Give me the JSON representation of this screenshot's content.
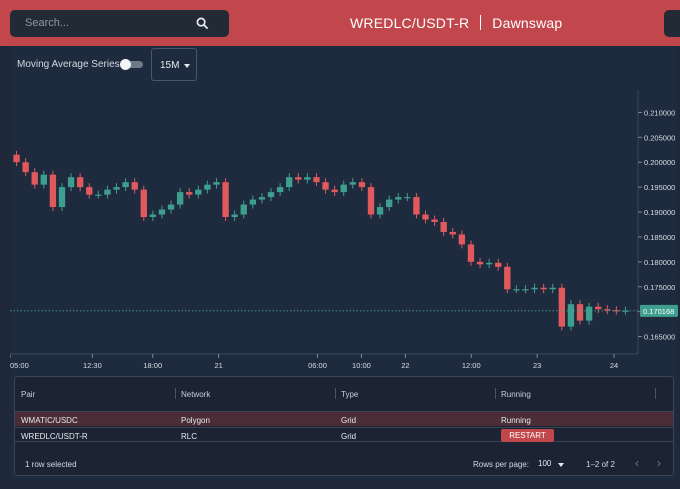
{
  "header": {
    "search_placeholder": "Search...",
    "pair": "WREDLC/USDT-R",
    "dex": "Dawnswap"
  },
  "controls": {
    "ma_label": "Moving Average Series:",
    "ma_enabled": false,
    "interval": "15M"
  },
  "colors": {
    "up": "#3e9f8f",
    "down": "#e05a5d",
    "accent": "#c1474c",
    "price_tag": "#3e9f8f"
  },
  "chart_data": {
    "type": "candlestick",
    "y_ticks": [
      "0.210000",
      "0.205000",
      "0.200000",
      "0.195000",
      "0.190000",
      "0.185000",
      "0.180000",
      "0.175000",
      "0.170000",
      "0.165000"
    ],
    "y_tick_values": [
      0.21,
      0.205,
      0.2,
      0.195,
      0.19,
      0.185,
      0.18,
      0.175,
      0.17,
      0.165
    ],
    "ylim": [
      0.1615,
      0.2145
    ],
    "x_ticks": [
      "05:00",
      "12:30",
      "18:00",
      "21",
      "06:00",
      "10:00",
      "22",
      "12:00",
      "23",
      "24"
    ],
    "x_tick_hours": [
      0,
      7.5,
      13,
      19,
      28,
      32,
      36,
      42,
      48,
      55
    ],
    "xlim": [
      0,
      57
    ],
    "last_price": 0.170168,
    "last_price_label": "0.170168",
    "closes": [
      0.2,
      0.198,
      0.1955,
      0.1975,
      0.191,
      0.195,
      0.197,
      0.195,
      0.1935,
      0.1935,
      0.1945,
      0.195,
      0.196,
      0.1945,
      0.189,
      0.1895,
      0.1905,
      0.1915,
      0.194,
      0.1935,
      0.1945,
      0.1955,
      0.196,
      0.189,
      0.1895,
      0.1915,
      0.1925,
      0.193,
      0.194,
      0.195,
      0.197,
      0.1965,
      0.197,
      0.196,
      0.1945,
      0.194,
      0.1955,
      0.196,
      0.195,
      0.1895,
      0.191,
      0.1925,
      0.193,
      0.193,
      0.1895,
      0.1885,
      0.188,
      0.186,
      0.1855,
      0.1835,
      0.18,
      0.1795,
      0.1798,
      0.179,
      0.1745,
      0.1745,
      0.1745,
      0.1748,
      0.1745,
      0.1748,
      0.167,
      0.1715,
      0.1682,
      0.171,
      0.1705,
      0.1703,
      0.1702,
      0.1702
    ]
  },
  "table": {
    "headers": [
      "Pair",
      "Network",
      "Type",
      "Running"
    ],
    "rows": [
      {
        "pair": "WMATIC/USDC",
        "network": "Polygon",
        "type": "Grid",
        "running": "Running"
      },
      {
        "pair": "WREDLC/USDT-R",
        "network": "RLC",
        "type": "Grid",
        "running": "RESTART"
      }
    ],
    "selected_text": "1 row selected",
    "rows_per_page_label": "Rows per page:",
    "rows_per_page": "100",
    "range": "1–2 of 2"
  }
}
